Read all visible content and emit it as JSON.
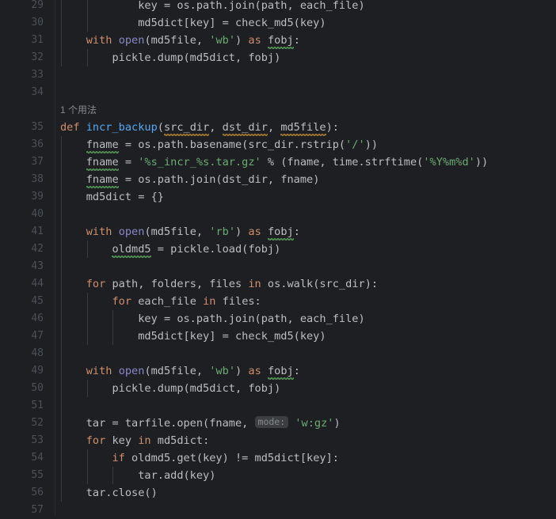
{
  "editor": {
    "language": "python",
    "theme": "dark",
    "background_color": "#1e1f22",
    "gutter_color": "#1e1f22",
    "line_number_color": "#4b5059",
    "default_text_color": "#bcbec4",
    "keyword_color": "#cf8e6d",
    "function_color": "#56a8f5",
    "builtin_color": "#8888c6",
    "string_color": "#6aab73",
    "inlay_hint_bg": "#3c3f41",
    "inlay_hint_fg": "#868a91",
    "codelens_color": "#868a91",
    "first_line": 29,
    "last_line": 57
  },
  "gutter": {
    "line_numbers": [
      "29",
      "30",
      "31",
      "32",
      "33",
      "34",
      "35",
      "36",
      "37",
      "38",
      "39",
      "40",
      "41",
      "42",
      "43",
      "44",
      "45",
      "46",
      "47",
      "48",
      "49",
      "50",
      "51",
      "52",
      "53",
      "54",
      "55",
      "56",
      "57"
    ]
  },
  "codelens": {
    "usages_label": "1 个用法",
    "for_line": 35
  },
  "inlay_hints": [
    {
      "label": "mode:",
      "line": 52
    }
  ],
  "lines": [
    {
      "number": 29,
      "text": "            key = os.path.join(path, each_file)"
    },
    {
      "number": 30,
      "text": "            md5dict[key] = check_md5(key)"
    },
    {
      "number": 31,
      "text": "    with open(md5file, 'wb') as fobj:"
    },
    {
      "number": 32,
      "text": "        pickle.dump(md5dict, fobj)"
    },
    {
      "number": 33,
      "text": ""
    },
    {
      "number": 34,
      "text": ""
    },
    {
      "number": 35,
      "text": "def incr_backup(src_dir, dst_dir, md5file):"
    },
    {
      "number": 36,
      "text": "    fname = os.path.basename(src_dir.rstrip('/'))"
    },
    {
      "number": 37,
      "text": "    fname = '%s_incr_%s.tar.gz' % (fname, time.strftime('%Y%m%d'))"
    },
    {
      "number": 38,
      "text": "    fname = os.path.join(dst_dir, fname)"
    },
    {
      "number": 39,
      "text": "    md5dict = {}"
    },
    {
      "number": 40,
      "text": ""
    },
    {
      "number": 41,
      "text": "    with open(md5file, 'rb') as fobj:"
    },
    {
      "number": 42,
      "text": "        oldmd5 = pickle.load(fobj)"
    },
    {
      "number": 43,
      "text": ""
    },
    {
      "number": 44,
      "text": "    for path, folders, files in os.walk(src_dir):"
    },
    {
      "number": 45,
      "text": "        for each_file in files:"
    },
    {
      "number": 46,
      "text": "            key = os.path.join(path, each_file)"
    },
    {
      "number": 47,
      "text": "            md5dict[key] = check_md5(key)"
    },
    {
      "number": 48,
      "text": ""
    },
    {
      "number": 49,
      "text": "    with open(md5file, 'wb') as fobj:"
    },
    {
      "number": 50,
      "text": "        pickle.dump(md5dict, fobj)"
    },
    {
      "number": 51,
      "text": ""
    },
    {
      "number": 52,
      "text": "    tar = tarfile.open(fname, mode: 'w:gz')"
    },
    {
      "number": 53,
      "text": "    for key in md5dict:"
    },
    {
      "number": 54,
      "text": "        if oldmd5.get(key) != md5dict[key]:"
    },
    {
      "number": 55,
      "text": "            tar.add(key)"
    },
    {
      "number": 56,
      "text": "    tar.close()"
    },
    {
      "number": 57,
      "text": ""
    }
  ],
  "warnings": [
    {
      "line": 35,
      "token": "src_dir",
      "severity": "weak-warning",
      "color": "#9a7233"
    },
    {
      "line": 35,
      "token": "dst_dir",
      "severity": "weak-warning",
      "color": "#9a7233"
    },
    {
      "line": 35,
      "token": "md5file",
      "severity": "weak-warning",
      "color": "#9a7233"
    },
    {
      "line": 31,
      "token": "fobj",
      "severity": "weak-warning",
      "color": "#4e8a52"
    },
    {
      "line": 36,
      "token": "fname",
      "severity": "weak-warning",
      "color": "#4e8a52"
    },
    {
      "line": 37,
      "token": "fname",
      "severity": "weak-warning",
      "color": "#4e8a52"
    },
    {
      "line": 38,
      "token": "fname",
      "severity": "weak-warning",
      "color": "#4e8a52"
    },
    {
      "line": 41,
      "token": "fobj",
      "severity": "weak-warning",
      "color": "#4e8a52"
    },
    {
      "line": 42,
      "token": "oldmd5",
      "severity": "weak-warning",
      "color": "#4e8a52"
    },
    {
      "line": 49,
      "token": "fobj",
      "severity": "weak-warning",
      "color": "#4e8a52"
    }
  ]
}
